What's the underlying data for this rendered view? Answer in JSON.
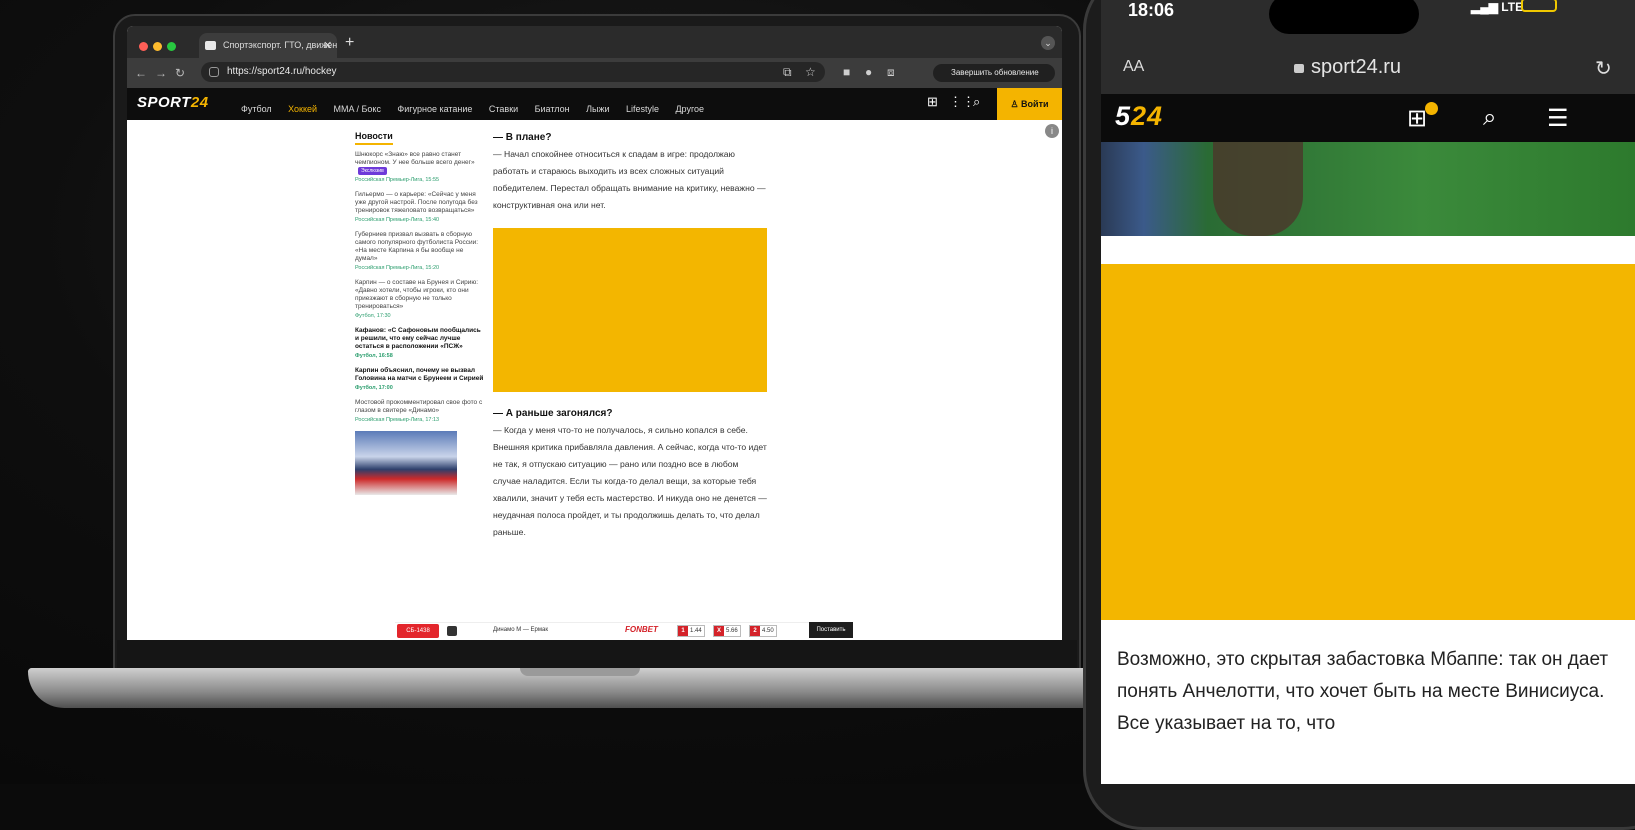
{
  "laptop": {
    "tab_title": "Спортэкспорт. ГТО, движение в...",
    "url": "https://sport24.ru/hockey",
    "update_button": "Завершить обновление",
    "site": {
      "logo_main": "SPORT",
      "logo_accent": "24",
      "nav": [
        "Футбол",
        "Хоккей",
        "MMA / Бокс",
        "Фигурное катание",
        "Ставки",
        "Биатлон",
        "Лыжи",
        "Lifestyle",
        "Другое"
      ],
      "active_nav": "Хоккей",
      "login": "Войти"
    },
    "news": {
      "title": "Новости",
      "items": [
        {
          "text": "Шнюкорс «Знаю» все равно станет чемпионом. У нее больше всего денег»",
          "badge": "Экслюзив",
          "meta": "Российская Премьер-Лига, 15:55",
          "bold": false
        },
        {
          "text": "Гильермо — о карьере: «Сейчас у меня уже другой настрой. После полугода без тренировок тяжеловато возвращаться»",
          "badge": "",
          "meta": "Российская Премьер-Лига, 15:40",
          "bold": false
        },
        {
          "text": "Губерниев призвал вызвать в сборную самого популярного футболиста России: «На месте Карпина я бы вообще не думал»",
          "badge": "",
          "meta": "Российская Премьер-Лига, 15:20",
          "bold": false
        },
        {
          "text": "Карпин — о составе на Брунея и Сирию: «Давно хотели, чтобы игроки, кто они приезжают в сборную не только тренироваться»",
          "badge": "",
          "meta": "Футбол, 17:30",
          "bold": false
        },
        {
          "text": "Кафанов: «С Сафоновым пообщались и решили, что ему сейчас лучше остаться в расположении «ПСЖ»",
          "badge": "",
          "meta": "Футбол, 16:58",
          "bold": true
        },
        {
          "text": "Карпин объяснил, почему не вызвал Головина на матчи с Брунеем и Сирией",
          "badge": "",
          "meta": "Футбол, 17:00",
          "bold": true
        },
        {
          "text": "Мостовой прокомментировал свое фото с глазом в свитере «Динамо»",
          "badge": "",
          "meta": "Российская Премьер-Лига, 17:13",
          "bold": false
        }
      ]
    },
    "article": {
      "q1": "— В плане?",
      "p1": "— Начал спокойнее относиться к спадам в игре: продолжаю работать и стараюсь выходить из всех сложных ситуаций победителем. Перестал обращать внимание на критику, неважно — конструктивная она или нет.",
      "q2": "— А раньше загонялся?",
      "p2": "— Когда у меня что-то не получалось, я сильно копался в себе. Внешняя критика прибавляла давления. А сейчас, когда что-то идет не так, я отпускаю ситуацию — рано или поздно все в любом случае наладится. Если ты когда-то делал вещи, за которые тебя хвалили, значит у тебя есть мастерство. И никуда оно не денется — неудачная полоса пройдет, и ты продолжишь делать то, что делал раньше."
    },
    "betbar": {
      "live": "СБ-1438",
      "teams": "Динамо М — Ермак",
      "bookmaker": "FONBET",
      "odds": [
        {
          "k": "1",
          "v": "1.44"
        },
        {
          "k": "X",
          "v": "5.66"
        },
        {
          "k": "2",
          "v": "4.50"
        }
      ],
      "bet": "Поставить"
    }
  },
  "phone": {
    "time": "18:06",
    "network": "LTE",
    "text_size": "AA",
    "domain": "sport24.ru",
    "logo_main": "5",
    "logo_accent": "24",
    "body_text": "Возможно, это скрытая забастовка Мбаппе: так он дает понять Анчелотти, что хочет быть на месте Винисиуса. Все указывает на то, что"
  },
  "colors": {
    "accent": "#f4b400",
    "ad": "#f3b600",
    "header": "#0d0d0d",
    "live": "#e3262c"
  },
  "icons": [
    "gift-icon",
    "grid-icon",
    "search-icon",
    "user-icon",
    "menu-icon",
    "reload-icon",
    "lock-icon"
  ]
}
